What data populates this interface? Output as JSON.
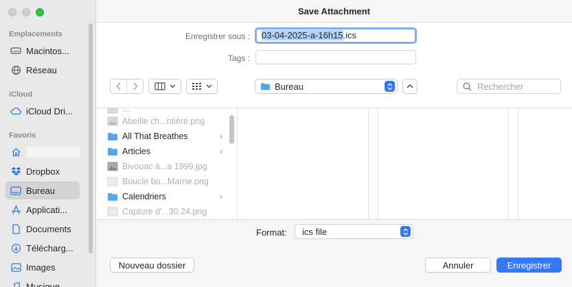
{
  "window": {
    "title": "Save Attachment"
  },
  "sidebar": {
    "sections": [
      {
        "label": "Emplacements",
        "items": [
          {
            "label": "Macintos...",
            "icon": "disk-icon"
          },
          {
            "label": "Réseau",
            "icon": "network-icon"
          }
        ]
      },
      {
        "label": "iCloud",
        "items": [
          {
            "label": "iCloud Dri...",
            "icon": "icloud-icon"
          }
        ]
      },
      {
        "label": "Favoris",
        "items": [
          {
            "label": "",
            "icon": "home-icon"
          },
          {
            "label": "Dropbox",
            "icon": "dropbox-icon"
          },
          {
            "label": "Bureau",
            "icon": "desktop-icon",
            "selected": true
          },
          {
            "label": "Applicati...",
            "icon": "apps-icon"
          },
          {
            "label": "Documents",
            "icon": "document-icon"
          },
          {
            "label": "Télécharg...",
            "icon": "download-icon"
          },
          {
            "label": "Images",
            "icon": "images-icon"
          },
          {
            "label": "Musique",
            "icon": "music-icon"
          }
        ]
      }
    ]
  },
  "form": {
    "save_as_label": "Enregistrer sous :",
    "filename_selected": "03-04-2025-a-16h15",
    "filename_ext": ".ics",
    "tags_label": "Tags :",
    "tags_value": ""
  },
  "toolbar": {
    "location": "Bureau",
    "search_placeholder": "Rechercher"
  },
  "files": [
    {
      "name": "...",
      "type": "image",
      "dim": true
    },
    {
      "name": "Abeille ch...ntière.png",
      "type": "image",
      "dim": true
    },
    {
      "name": "All That Breathes",
      "type": "folder",
      "dim": false
    },
    {
      "name": "Articles",
      "type": "folder",
      "dim": false
    },
    {
      "name": "Bivouac à...a 1999.jpg",
      "type": "image",
      "dim": true
    },
    {
      "name": "Boucle bo...Marne.png",
      "type": "image",
      "dim": true
    },
    {
      "name": "Calendriers",
      "type": "folder",
      "dim": false
    },
    {
      "name": "Capture d'...30.24.png",
      "type": "image",
      "dim": true
    }
  ],
  "bottom": {
    "format_label": "Format:",
    "format_value": "ics file",
    "new_folder": "Nouveau dossier",
    "cancel": "Annuler",
    "save": "Enregistrer"
  },
  "colors": {
    "accent": "#3478f6",
    "selection": "#b3d1f6",
    "focus_ring": "#80acf2"
  }
}
